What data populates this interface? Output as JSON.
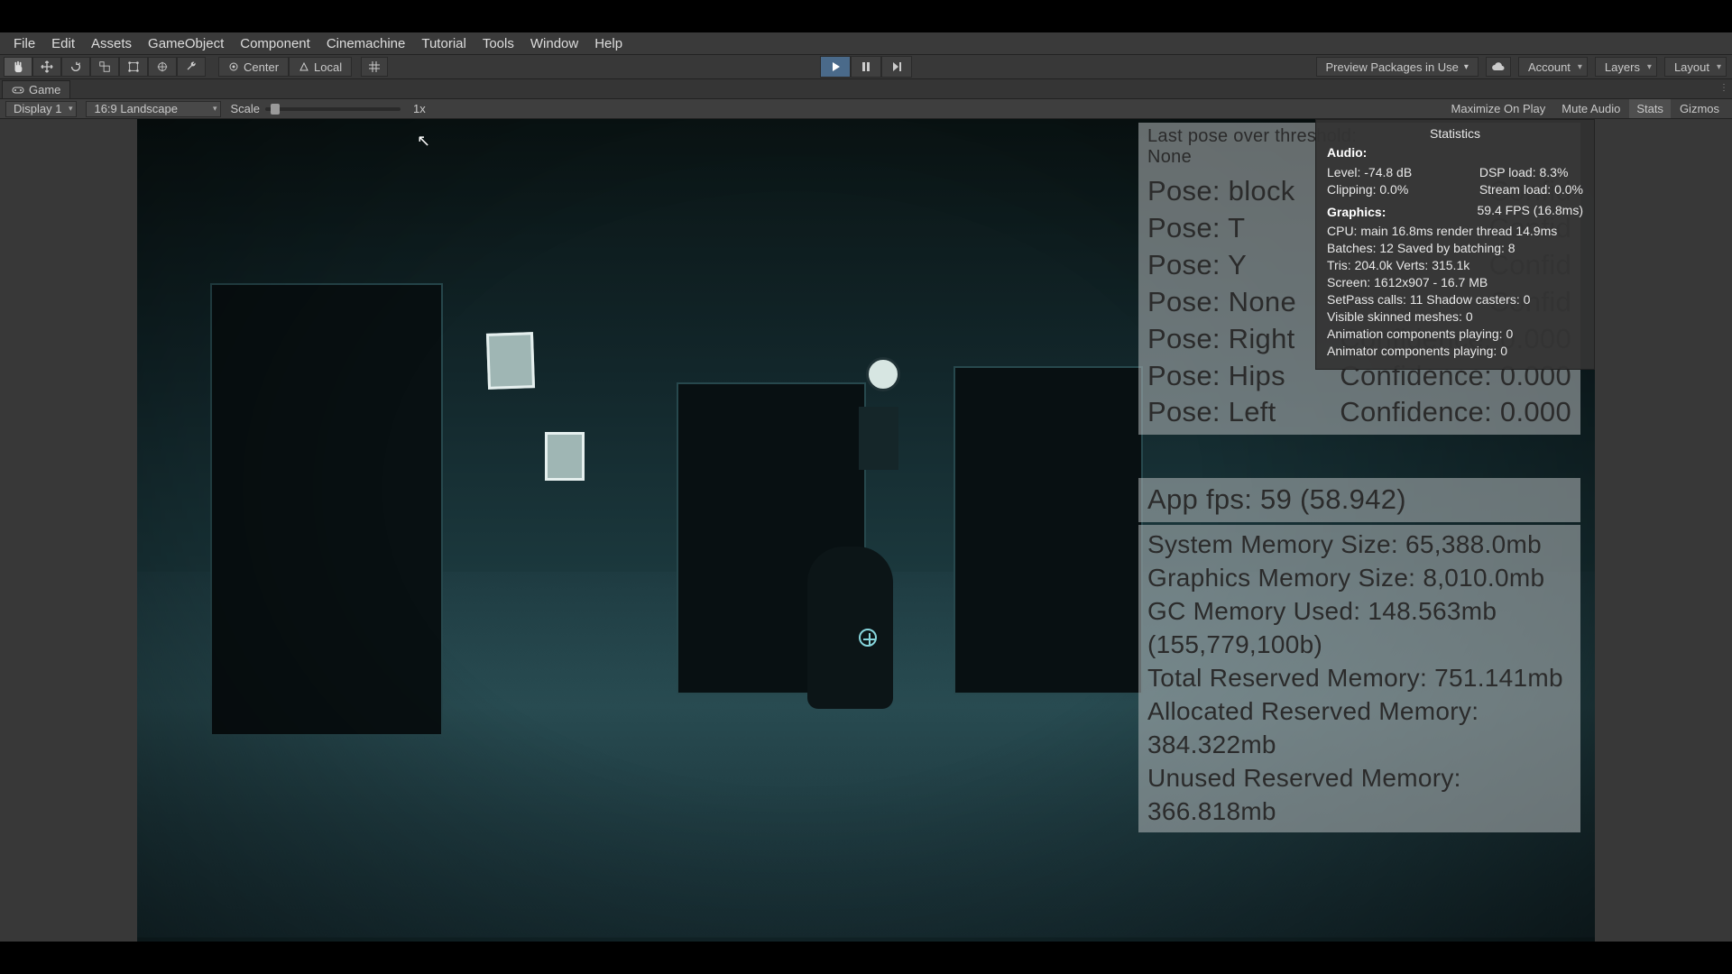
{
  "menu": {
    "items": [
      "File",
      "Edit",
      "Assets",
      "GameObject",
      "Component",
      "Cinemachine",
      "Tutorial",
      "Tools",
      "Window",
      "Help"
    ]
  },
  "toolbar": {
    "pivot": "Center",
    "handle": "Local",
    "preview_packages": "Preview Packages in Use",
    "account": "Account",
    "layers": "Layers",
    "layout": "Layout"
  },
  "tabs": {
    "game": "Game"
  },
  "controlbar": {
    "display": "Display 1",
    "aspect": "16:9 Landscape",
    "scale_label": "Scale",
    "scale_value": "1x",
    "right": [
      "Maximize On Play",
      "Mute Audio",
      "Stats",
      "Gizmos"
    ]
  },
  "hud": {
    "last_pose_label": "Last pose over threshold:",
    "last_pose_value": "None",
    "poses": [
      {
        "name": "Pose: block",
        "conf": "Confid"
      },
      {
        "name": "Pose: T",
        "conf": "Confid"
      },
      {
        "name": "Pose: Y",
        "conf": "Confid"
      },
      {
        "name": "Pose: None",
        "conf": "Confid"
      },
      {
        "name": "Pose: Right",
        "conf": "Confidence: 0.000"
      },
      {
        "name": "Pose: Hips",
        "conf": "Confidence: 0.000"
      },
      {
        "name": "Pose: Left",
        "conf": "Confidence: 0.000"
      }
    ],
    "fps": "App fps: 59 (58.942)",
    "mem": [
      "System Memory Size: 65,388.0mb",
      "Graphics Memory Size: 8,010.0mb",
      "GC Memory Used: 148.563mb (155,779,100b)",
      "Total Reserved Memory: 751.141mb",
      "Allocated Reserved Memory: 384.322mb",
      "Unused Reserved Memory: 366.818mb"
    ]
  },
  "stats": {
    "title": "Statistics",
    "audio_h": "Audio:",
    "audio_left": [
      "Level: -74.8 dB",
      "Clipping: 0.0%"
    ],
    "audio_right": [
      "DSP load: 8.3%",
      "Stream load: 0.0%"
    ],
    "gfx_h": "Graphics:",
    "gfx_fps": "59.4 FPS (16.8ms)",
    "gfx_lines_left": [
      "CPU: main 16.8ms  render thread 14.9ms",
      "Batches: 12        Saved by batching: 8",
      "Tris: 204.0k     Verts: 315.1k",
      "Screen: 1612x907 - 16.7 MB",
      "SetPass calls: 11          Shadow casters: 0",
      "Visible skinned meshes: 0",
      "Animation components playing: 0",
      "Animator components playing: 0"
    ]
  }
}
